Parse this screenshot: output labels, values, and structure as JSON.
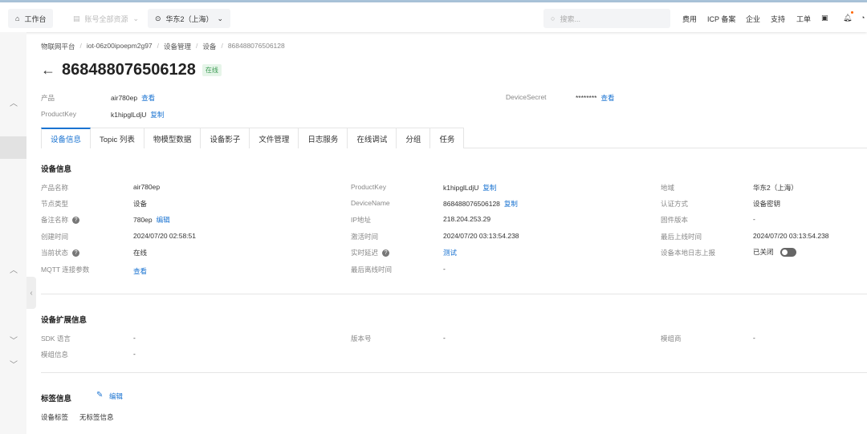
{
  "topbar": {
    "workbench": "工作台",
    "resources": "账号全部资源",
    "region": "华东2（上海）",
    "search_placeholder": "搜索...",
    "nav": [
      "费用",
      "ICP 备案",
      "企业",
      "支持",
      "工单"
    ]
  },
  "breadcrumb": [
    "物联网平台",
    "iot-06z00ipoepm2g97",
    "设备管理",
    "设备",
    "868488076506128"
  ],
  "header": {
    "title": "868488076506128",
    "status": "在线"
  },
  "summary": {
    "product_label": "产品",
    "product_value": "air780ep",
    "product_link": "查看",
    "pk_label": "ProductKey",
    "pk_value": "k1hipglLdjU",
    "pk_link": "复制",
    "secret_label": "DeviceSecret",
    "secret_value": "********",
    "secret_link": "查看"
  },
  "tabs": [
    "设备信息",
    "Topic 列表",
    "物模型数据",
    "设备影子",
    "文件管理",
    "日志服务",
    "在线调试",
    "分组",
    "任务"
  ],
  "device_info": {
    "title": "设备信息",
    "col1": [
      {
        "label": "产品名称",
        "value": "air780ep"
      },
      {
        "label": "节点类型",
        "value": "设备"
      },
      {
        "label": "备注名称",
        "value": "780ep",
        "link": "编辑"
      },
      {
        "label": "创建时间",
        "value": "2024/07/20 02:58:51"
      },
      {
        "label": "当前状态",
        "value": "在线"
      },
      {
        "label": "MQTT 连接参数",
        "link": "查看"
      }
    ],
    "col2": [
      {
        "label": "ProductKey",
        "value": "k1hipglLdjU",
        "link": "复制"
      },
      {
        "label": "DeviceName",
        "value": "868488076506128",
        "link": "复制"
      },
      {
        "label": "IP地址",
        "value": "218.204.253.29"
      },
      {
        "label": "激活时间",
        "value": "2024/07/20 03:13:54.238"
      },
      {
        "label": "实时延迟",
        "link": "测试"
      },
      {
        "label": "最后离线时间",
        "value": "-"
      }
    ],
    "col3": [
      {
        "label": "地域",
        "value": "华东2（上海）"
      },
      {
        "label": "认证方式",
        "value": "设备密钥"
      },
      {
        "label": "固件版本",
        "value": "-"
      },
      {
        "label": "最后上线时间",
        "value": "2024/07/20 03:13:54.238"
      },
      {
        "label": "设备本地日志上报",
        "value": "已关闭"
      }
    ]
  },
  "ext_info": {
    "title": "设备扩展信息",
    "rows": [
      {
        "label": "SDK 语言",
        "value": "-"
      },
      {
        "label": "版本号",
        "value": "-"
      },
      {
        "label": "模组商",
        "value": "-"
      },
      {
        "label": "模组信息",
        "value": "-"
      }
    ]
  },
  "tag_info": {
    "title": "标签信息",
    "edit": "编辑",
    "label": "设备标签",
    "value": "无标签信息"
  }
}
